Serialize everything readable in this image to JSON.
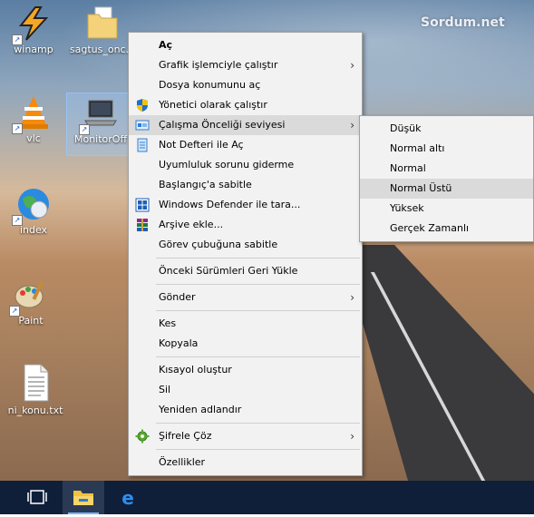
{
  "watermark": "Sordum.net",
  "desktop_icons": [
    {
      "label": "winamp",
      "icon": "winamp-icon"
    },
    {
      "label": "sagtus_onc...",
      "icon": "folder-icon"
    },
    {
      "label": "vlc",
      "icon": "vlc-icon"
    },
    {
      "label": "MonitorOff",
      "icon": "laptop-icon"
    },
    {
      "label": "index",
      "icon": "globe-icon"
    },
    {
      "label": "Paint",
      "icon": "paint-icon"
    },
    {
      "label": "ni_konu.txt",
      "icon": "text-file-icon"
    }
  ],
  "context_menu": {
    "items": [
      {
        "label": "Aç"
      },
      {
        "label": "Grafik işlemciyle çalıştır"
      },
      {
        "label": "Dosya konumunu aç"
      },
      {
        "label": "Yönetici olarak çalıştır"
      },
      {
        "label": "Çalışma Önceliği seviyesi"
      },
      {
        "label": "Not Defteri ile Aç"
      },
      {
        "label": "Uyumluluk sorunu giderme"
      },
      {
        "label": "Başlangıç'a sabitle"
      },
      {
        "label": "Windows Defender ile tara..."
      },
      {
        "label": "Arşive ekle..."
      },
      {
        "label": "Görev çubuğuna sabitle"
      },
      {
        "label": "Önceki Sürümleri Geri Yükle"
      },
      {
        "label": "Gönder"
      },
      {
        "label": "Kes"
      },
      {
        "label": "Kopyala"
      },
      {
        "label": "Kısayol oluştur"
      },
      {
        "label": "Sil"
      },
      {
        "label": "Yeniden adlandır"
      },
      {
        "label": "Şifrele  Çöz"
      },
      {
        "label": "Özellikler"
      }
    ]
  },
  "submenu": {
    "items": [
      {
        "label": "Düşük"
      },
      {
        "label": "Normal altı"
      },
      {
        "label": "Normal"
      },
      {
        "label": "Normal Üstü"
      },
      {
        "label": "Yüksek"
      },
      {
        "label": "Gerçek Zamanlı"
      }
    ]
  },
  "taskbar": {
    "items": [
      "task-view-icon",
      "file-explorer-icon",
      "edge-icon"
    ]
  },
  "colors": {
    "menu_bg": "#f2f2f2",
    "highlight": "#dadada",
    "taskbar": "#0f1f3a"
  }
}
